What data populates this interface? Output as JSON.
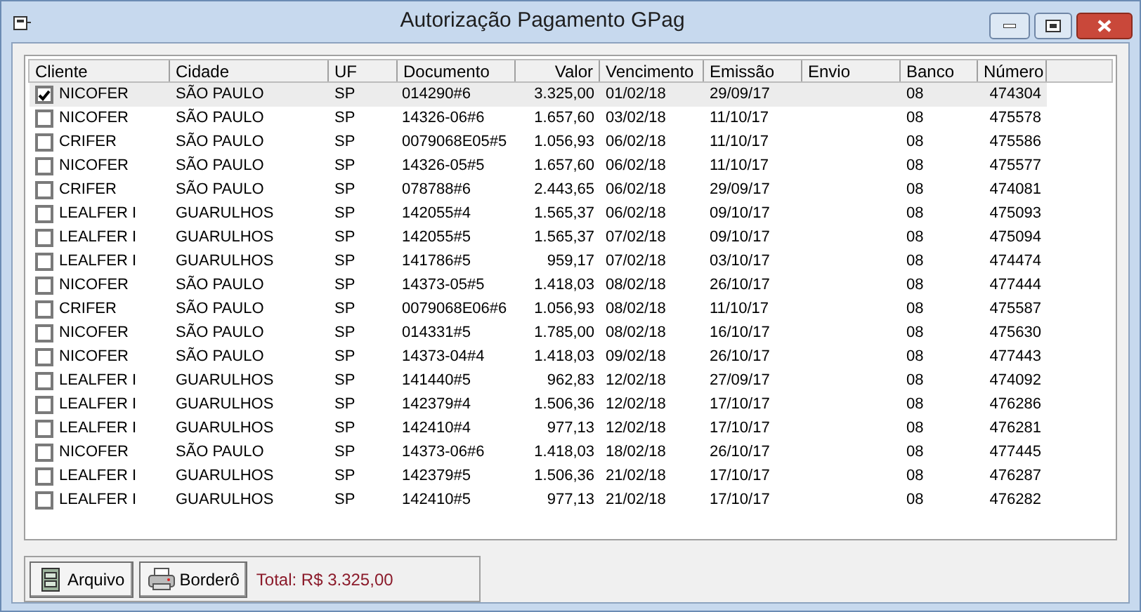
{
  "window": {
    "title": "Autorização Pagamento GPag"
  },
  "table": {
    "columns": [
      "Cliente",
      "Cidade",
      "UF",
      "Documento",
      "Valor",
      "Vencimento",
      "Emissão",
      "Envio",
      "Banco",
      "Número"
    ],
    "rows": [
      {
        "cliente": "NICOFER",
        "cidade": "SÃO PAULO",
        "uf": "SP",
        "documento": "014290#6",
        "valor": "3.325,00",
        "vencimento": "01/02/18",
        "emissao": "29/09/17",
        "banco": "08",
        "numero": "474304",
        "checked": true,
        "selected": true
      },
      {
        "cliente": "NICOFER",
        "cidade": "SÃO PAULO",
        "uf": "SP",
        "documento": "14326-06#6",
        "valor": "1.657,60",
        "vencimento": "03/02/18",
        "emissao": "11/10/17",
        "banco": "08",
        "numero": "475578",
        "checked": false,
        "selected": false
      },
      {
        "cliente": "CRIFER",
        "cidade": "SÃO PAULO",
        "uf": "SP",
        "documento": "0079068E05#5",
        "valor": "1.056,93",
        "vencimento": "06/02/18",
        "emissao": "11/10/17",
        "banco": "08",
        "numero": "475586",
        "checked": false,
        "selected": false
      },
      {
        "cliente": "NICOFER",
        "cidade": "SÃO PAULO",
        "uf": "SP",
        "documento": "14326-05#5",
        "valor": "1.657,60",
        "vencimento": "06/02/18",
        "emissao": "11/10/17",
        "banco": "08",
        "numero": "475577",
        "checked": false,
        "selected": false
      },
      {
        "cliente": "CRIFER",
        "cidade": "SÃO PAULO",
        "uf": "SP",
        "documento": "078788#6",
        "valor": "2.443,65",
        "vencimento": "06/02/18",
        "emissao": "29/09/17",
        "banco": "08",
        "numero": "474081",
        "checked": false,
        "selected": false
      },
      {
        "cliente": "LEALFER I",
        "cidade": "GUARULHOS",
        "uf": "SP",
        "documento": "142055#4",
        "valor": "1.565,37",
        "vencimento": "06/02/18",
        "emissao": "09/10/17",
        "banco": "08",
        "numero": "475093",
        "checked": false,
        "selected": false
      },
      {
        "cliente": "LEALFER I",
        "cidade": "GUARULHOS",
        "uf": "SP",
        "documento": "142055#5",
        "valor": "1.565,37",
        "vencimento": "07/02/18",
        "emissao": "09/10/17",
        "banco": "08",
        "numero": "475094",
        "checked": false,
        "selected": false
      },
      {
        "cliente": "LEALFER I",
        "cidade": "GUARULHOS",
        "uf": "SP",
        "documento": "141786#5",
        "valor": "959,17",
        "vencimento": "07/02/18",
        "emissao": "03/10/17",
        "banco": "08",
        "numero": "474474",
        "checked": false,
        "selected": false
      },
      {
        "cliente": "NICOFER",
        "cidade": "SÃO PAULO",
        "uf": "SP",
        "documento": "14373-05#5",
        "valor": "1.418,03",
        "vencimento": "08/02/18",
        "emissao": "26/10/17",
        "banco": "08",
        "numero": "477444",
        "checked": false,
        "selected": false
      },
      {
        "cliente": "CRIFER",
        "cidade": "SÃO PAULO",
        "uf": "SP",
        "documento": "0079068E06#6",
        "valor": "1.056,93",
        "vencimento": "08/02/18",
        "emissao": "11/10/17",
        "banco": "08",
        "numero": "475587",
        "checked": false,
        "selected": false
      },
      {
        "cliente": "NICOFER",
        "cidade": "SÃO PAULO",
        "uf": "SP",
        "documento": "014331#5",
        "valor": "1.785,00",
        "vencimento": "08/02/18",
        "emissao": "16/10/17",
        "banco": "08",
        "numero": "475630",
        "checked": false,
        "selected": false
      },
      {
        "cliente": "NICOFER",
        "cidade": "SÃO PAULO",
        "uf": "SP",
        "documento": "14373-04#4",
        "valor": "1.418,03",
        "vencimento": "09/02/18",
        "emissao": "26/10/17",
        "banco": "08",
        "numero": "477443",
        "checked": false,
        "selected": false
      },
      {
        "cliente": "LEALFER I",
        "cidade": "GUARULHOS",
        "uf": "SP",
        "documento": "141440#5",
        "valor": "962,83",
        "vencimento": "12/02/18",
        "emissao": "27/09/17",
        "banco": "08",
        "numero": "474092",
        "checked": false,
        "selected": false
      },
      {
        "cliente": "LEALFER I",
        "cidade": "GUARULHOS",
        "uf": "SP",
        "documento": "142379#4",
        "valor": "1.506,36",
        "vencimento": "12/02/18",
        "emissao": "17/10/17",
        "banco": "08",
        "numero": "476286",
        "checked": false,
        "selected": false
      },
      {
        "cliente": "LEALFER I",
        "cidade": "GUARULHOS",
        "uf": "SP",
        "documento": "142410#4",
        "valor": "977,13",
        "vencimento": "12/02/18",
        "emissao": "17/10/17",
        "banco": "08",
        "numero": "476281",
        "checked": false,
        "selected": false
      },
      {
        "cliente": "NICOFER",
        "cidade": "SÃO PAULO",
        "uf": "SP",
        "documento": "14373-06#6",
        "valor": "1.418,03",
        "vencimento": "18/02/18",
        "emissao": "26/10/17",
        "banco": "08",
        "numero": "477445",
        "checked": false,
        "selected": false
      },
      {
        "cliente": "LEALFER I",
        "cidade": "GUARULHOS",
        "uf": "SP",
        "documento": "142379#5",
        "valor": "1.506,36",
        "vencimento": "21/02/18",
        "emissao": "17/10/17",
        "banco": "08",
        "numero": "476287",
        "checked": false,
        "selected": false
      },
      {
        "cliente": "LEALFER I",
        "cidade": "GUARULHOS",
        "uf": "SP",
        "documento": "142410#5",
        "valor": "977,13",
        "vencimento": "21/02/18",
        "emissao": "17/10/17",
        "banco": "08",
        "numero": "476282",
        "checked": false,
        "selected": false
      }
    ]
  },
  "buttons": [
    "Arquivo",
    "Borderô"
  ],
  "total": "Total: R$ 3.325,00"
}
